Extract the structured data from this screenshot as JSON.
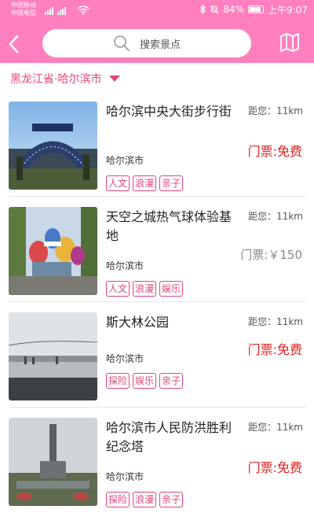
{
  "status_bar": {
    "carrier1": "中国移动",
    "carrier2": "中国电信",
    "battery": "84%",
    "time": "上午9:07"
  },
  "search": {
    "placeholder": "搜索景点"
  },
  "location": "黑龙江省·哈尔滨市",
  "icons": {
    "back": "chevron-left-icon",
    "search": "magnifier-icon",
    "map": "folded-map-icon",
    "location_dropdown": "triangle-down-icon"
  },
  "colors": {
    "header_bg": "#ff7fbf",
    "accent": "#e0457f",
    "free_price": "#e02020",
    "paid_price": "#888888"
  },
  "spots": [
    {
      "name": "哈尔滨中央大街步行街",
      "city": "哈尔滨市",
      "distance": "距您：11km",
      "price": "门票:免费",
      "tags": [
        "人文",
        "浪漫",
        "亲子"
      ]
    },
    {
      "name": "天空之城热气球体验基地",
      "city": "哈尔滨市",
      "distance": "距您：11km",
      "price": "门票:￥150",
      "tags": [
        "人文",
        "浪漫",
        "娱乐"
      ]
    },
    {
      "name": "斯大林公园",
      "city": "哈尔滨市",
      "distance": "距您：11km",
      "price": "门票:免费",
      "tags": [
        "探险",
        "娱乐",
        "亲子"
      ]
    },
    {
      "name": "哈尔滨市人民防洪胜利纪念塔",
      "city": "哈尔滨市",
      "distance": "距您：11km",
      "price": "门票:免费",
      "tags": [
        "探险",
        "浪漫",
        "亲子"
      ]
    }
  ]
}
